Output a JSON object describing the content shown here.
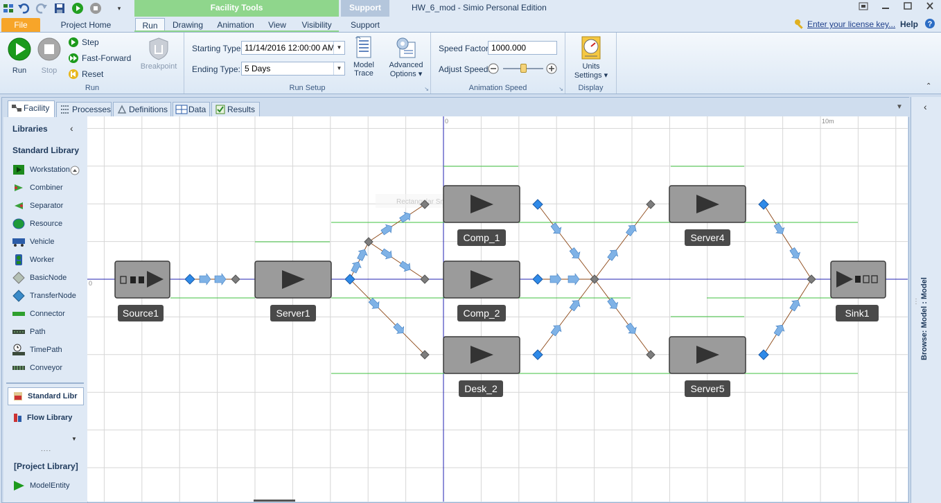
{
  "window": {
    "title": "HW_6_mod - Simio Personal Edition",
    "context_tab_facility": "Facility Tools",
    "context_tab_support": "Support"
  },
  "ribbon_tabs": {
    "file": "File",
    "project_home": "Project Home",
    "run": "Run",
    "drawing": "Drawing",
    "animation": "Animation",
    "view": "View",
    "visibility": "Visibility",
    "support": "Support"
  },
  "header_right": {
    "license_link": "Enter your license key...",
    "help": "Help"
  },
  "run_group": {
    "run": "Run",
    "stop": "Stop",
    "step": "Step",
    "fast_forward": "Fast-Forward",
    "reset": "Reset",
    "label": "Run"
  },
  "breakpoint": {
    "label": "Breakpoint"
  },
  "run_setup": {
    "starting_type_label": "Starting Type:",
    "starting_type_value": "11/14/2016 12:00:00 AM",
    "ending_type_label": "Ending Type:",
    "ending_type_value": "5 Days",
    "model_trace_1": "Model",
    "model_trace_2": "Trace",
    "advanced_1": "Advanced",
    "advanced_2": "Options",
    "label": "Run Setup"
  },
  "animation_speed": {
    "speed_factor_label": "Speed Factor:",
    "speed_factor_value": "1000.000",
    "adjust_speed_label": "Adjust Speed:",
    "slider_level": 0.5,
    "label": "Animation Speed"
  },
  "display_group": {
    "units_1": "Units",
    "units_2": "Settings",
    "label": "Display"
  },
  "doc_tabs": {
    "facility": "Facility",
    "processes": "Processes",
    "definitions": "Definitions",
    "data": "Data",
    "results": "Results"
  },
  "libraries": {
    "header": "Libraries",
    "standard_header": "Standard Library",
    "items": [
      "Workstation",
      "Combiner",
      "Separator",
      "Resource",
      "Vehicle",
      "Worker",
      "BasicNode",
      "TransferNode",
      "Connector",
      "Path",
      "TimePath",
      "Conveyor"
    ],
    "standard_library_tab": "Standard Libr",
    "flow_library_tab": "Flow Library",
    "project_header": "[Project Library]",
    "project_items": [
      "ModelEntity"
    ]
  },
  "canvas": {
    "ruler_zero_top": "0",
    "ruler_ten": "10m",
    "ruler_zero_left": "0",
    "ghost_text": "Rectangular Snip",
    "objects": {
      "source1": "Source1",
      "server1": "Server1",
      "comp_1": "Comp_1",
      "comp_2": "Comp_2",
      "desk_2": "Desk_2",
      "server4": "Server4",
      "server5": "Server5",
      "sink1": "Sink1"
    }
  },
  "browse_panel": {
    "label": "Browse: Model : Model"
  },
  "colors": {
    "context_green": "#8fd68c",
    "file_orange": "#f7a529",
    "node_blue": "#2f8ae8",
    "node_gray": "#7d7d7d",
    "object_gray": "#9b9b9b",
    "label_bg": "#4a4a4a",
    "path_line": "#8b4513",
    "queue_green": "#3fc23f"
  }
}
